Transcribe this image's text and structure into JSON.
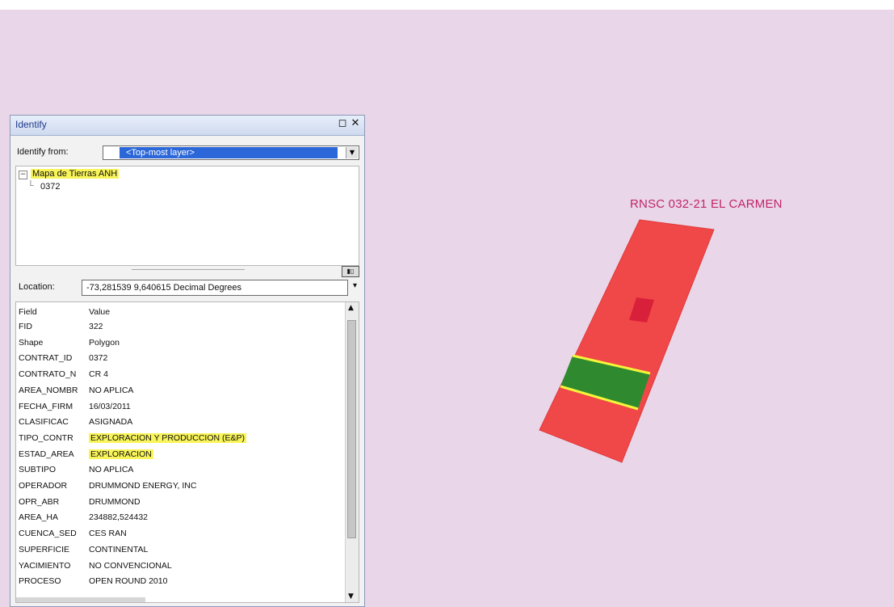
{
  "identify": {
    "title": "Identify",
    "close_glyph": "✕",
    "restore_glyph": "◻",
    "identify_from_label": "Identify from:",
    "identify_from_value": "<Top-most layer>",
    "tree": {
      "layer_name": "Mapa de Tierras ANH",
      "feature_id": "0372",
      "expander": "−"
    },
    "location_label": "Location:",
    "location_value": "-73,281539  9,640615 Decimal Degrees",
    "table": {
      "header_field": "Field",
      "header_value": "Value",
      "rows": [
        {
          "field": "FID",
          "value": "322"
        },
        {
          "field": "Shape",
          "value": "Polygon"
        },
        {
          "field": "CONTRAT_ID",
          "value": "0372"
        },
        {
          "field": "CONTRATO_N",
          "value": "CR 4"
        },
        {
          "field": "AREA_NOMBR",
          "value": "NO APLICA"
        },
        {
          "field": "FECHA_FIRM",
          "value": "16/03/2011"
        },
        {
          "field": "CLASIFICAC",
          "value": "ASIGNADA"
        },
        {
          "field": "TIPO_CONTR",
          "value": "EXPLORACION Y PRODUCCION (E&P)"
        },
        {
          "field": "ESTAD_AREA",
          "value": "EXPLORACION"
        },
        {
          "field": "SUBTIPO",
          "value": "NO APLICA"
        },
        {
          "field": "OPERADOR",
          "value": "DRUMMOND ENERGY, INC"
        },
        {
          "field": "OPR_ABR",
          "value": "DRUMMOND"
        },
        {
          "field": "AREA_HA",
          "value": "234882,524432"
        },
        {
          "field": "CUENCA_SED",
          "value": "CES RAN"
        },
        {
          "field": "SUPERFICIE",
          "value": "CONTINENTAL"
        },
        {
          "field": "YACIMIENTO",
          "value": "NO CONVENCIONAL"
        },
        {
          "field": "PROCESO",
          "value": "OPEN ROUND 2010"
        }
      ]
    }
  },
  "map": {
    "label": "RNSC 032-21 EL CARMEN",
    "colors": {
      "background": "#e9d6e9",
      "block_fill": "#f04848",
      "inner_square": "#d9203a",
      "band_fill": "#2f8a2f",
      "band_edge": "#f5f53a",
      "label": "#c0266a"
    }
  },
  "highlight_color": "#f8f45a"
}
